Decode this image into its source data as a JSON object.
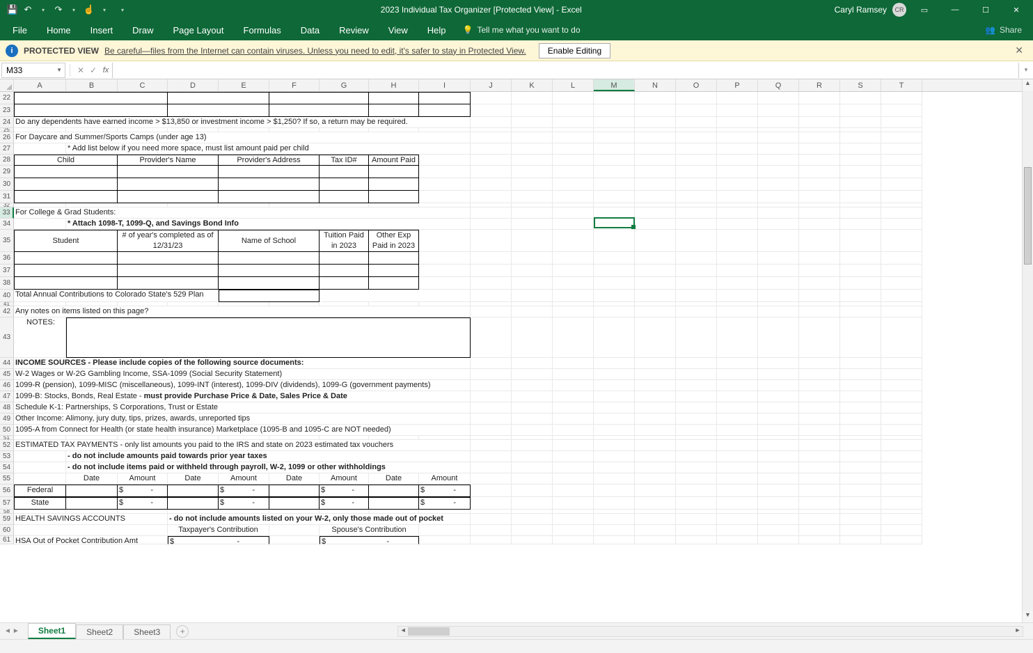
{
  "title": "2023 Individual Tax Organizer  [Protected View]  -  Excel",
  "user": {
    "name": "Caryl Ramsey",
    "initials": "CR"
  },
  "qat": {
    "save": "save-icon",
    "undo": "undo-icon",
    "redo": "redo-icon",
    "touch": "touch-mode-icon",
    "customize": "customize-qat-icon"
  },
  "tabs": [
    "File",
    "Home",
    "Insert",
    "Draw",
    "Page Layout",
    "Formulas",
    "Data",
    "Review",
    "View",
    "Help"
  ],
  "tell_me": "Tell me what you want to do",
  "share": "Share",
  "protected": {
    "label": "PROTECTED VIEW",
    "msg": "Be careful—files from the Internet can contain viruses. Unless you need to edit, it's safer to stay in Protected View.",
    "button": "Enable Editing"
  },
  "name_box": "M33",
  "selected": {
    "col": "M",
    "row": 33
  },
  "columns": [
    "A",
    "B",
    "C",
    "D",
    "E",
    "F",
    "G",
    "H",
    "I",
    "J",
    "K",
    "L",
    "M",
    "N",
    "O",
    "P",
    "Q",
    "R",
    "S",
    "T"
  ],
  "rows": {
    "r24": "Do any dependents have earned income > $13,850 or investment income > $1,250?  If so, a return may be required.",
    "r26": "For Daycare and Summer/Sports Camps (under age 13)",
    "r27": "* Add list below if you need more space, must list amount paid per child",
    "r28": {
      "a": "Child",
      "b": "Provider's Name",
      "c": "Provider's Address",
      "d": "Tax ID#",
      "e": "Amount Paid"
    },
    "r33": "For College & Grad Students:",
    "r34": "* Attach 1098-T, 1099-Q, and Savings Bond Info",
    "r35": {
      "a": "Student",
      "b1": "# of year's completed as of",
      "b2": "12/31/23",
      "c": "Name of School",
      "d1": "Tuition Paid",
      "d2": "in 2023",
      "e1": "Other Exp",
      "e2": "Paid in 2023"
    },
    "r40": "Total Annual Contributions to Colorado State's 529 Plan",
    "r42": "Any notes on items listed on this page?",
    "r43_notes": "NOTES:",
    "r44": "INCOME SOURCES - Please include copies of the following source documents:",
    "r45": "W-2 Wages or W-2G Gambling Income, SSA-1099 (Social Security Statement)",
    "r46": "1099-R (pension), 1099-MISC (miscellaneous), 1099-INT (interest), 1099-DIV (dividends), 1099-G (government payments)",
    "r47a": "1099-B: Stocks, Bonds, Real Estate - ",
    "r47b": "must provide Purchase Price & Date, Sales Price & Date",
    "r48": "Schedule K-1: Partnerships, S Corporations, Trust or Estate",
    "r49": "Other Income: Alimony, jury duty, tips, prizes, awards, unreported tips",
    "r50": "1095-A from Connect for Health (or state health insurance) Marketplace (1095-B and 1095-C are NOT needed)",
    "r52": "ESTIMATED TAX PAYMENTS - only list amounts you paid to the IRS and state on 2023 estimated tax vouchers",
    "r53": "- do not include amounts paid towards prior year taxes",
    "r54": "- do not include items paid or withheld through payroll, W-2, 1099 or other withholdings",
    "r55": {
      "date": "Date",
      "amount": "Amount"
    },
    "r56": {
      "label": "Federal",
      "dollar": "$",
      "dash": "-"
    },
    "r57": {
      "label": "State",
      "dollar": "$",
      "dash": "-"
    },
    "r59a": "HEALTH SAVINGS ACCOUNTS",
    "r59b": "- do not include amounts listed on your W-2, only those made out of pocket",
    "r60": {
      "a": "Taxpayer's Contribution",
      "b": "Spouse's Contribution"
    },
    "r61": {
      "label": "HSA Out of Pocket Contribution Amt",
      "dollar": "$",
      "dash": "-"
    }
  },
  "sheets": [
    "Sheet1",
    "Sheet2",
    "Sheet3"
  ],
  "active_sheet": 0
}
